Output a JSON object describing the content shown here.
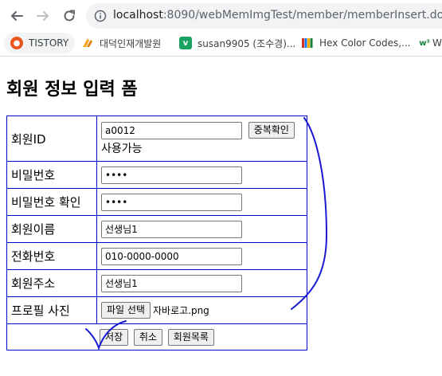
{
  "browser": {
    "url_host": "localhost",
    "url_rest": ":8090/webMemImgTest/member/memberInsert.do",
    "bookmarks": [
      {
        "label": "TISTORY"
      },
      {
        "label": "대덕인재개발원"
      },
      {
        "label": "susan9905 (조수경)..."
      },
      {
        "label": "Hex Color Codes,..."
      },
      {
        "label": "W"
      }
    ]
  },
  "page": {
    "title": "회원 정보 입력 폼"
  },
  "form": {
    "member_id_label": "회원ID",
    "member_id_value": "a0012",
    "dup_check_label": "중복확인",
    "availability": "사용가능",
    "password_label": "비밀번호",
    "password_value": "1234",
    "password_confirm_label": "비밀번호 확인",
    "password_confirm_value": "1234",
    "name_label": "회원이름",
    "name_value": "선생님1",
    "phone_label": "전화번호",
    "phone_value": "010-0000-0000",
    "address_label": "회원주소",
    "address_value": "선생님1",
    "photo_label": "프로필 사진",
    "file_button_label": "파일 선택",
    "file_name": "자바로고.png",
    "save_label": "저장",
    "cancel_label": "취소",
    "list_label": "회원목록"
  }
}
